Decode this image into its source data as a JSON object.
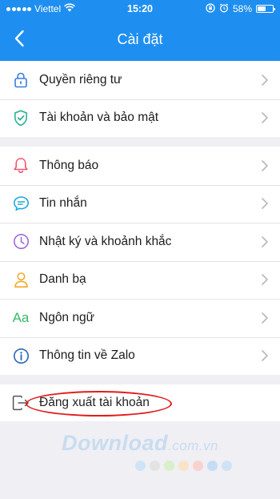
{
  "status_bar": {
    "carrier": "Viettel",
    "time": "15:20",
    "battery": "58%",
    "battery_level": 0.58
  },
  "header": {
    "title": "Cài đặt"
  },
  "sections": [
    {
      "items": [
        {
          "icon": "lock-icon",
          "label": "Quyền riêng tư"
        },
        {
          "icon": "shield-icon",
          "label": "Tài khoản và bảo mật"
        }
      ]
    },
    {
      "items": [
        {
          "icon": "bell-icon",
          "label": "Thông báo"
        },
        {
          "icon": "chat-bubble-icon",
          "label": "Tin nhắn"
        },
        {
          "icon": "clock-icon",
          "label": "Nhật ký và khoảnh khắc"
        },
        {
          "icon": "person-icon",
          "label": "Danh bạ"
        },
        {
          "icon": "language-icon",
          "label": "Ngôn ngữ",
          "icon_text": "Aa"
        },
        {
          "icon": "info-icon",
          "label": "Thông tin về Zalo"
        }
      ]
    }
  ],
  "logout": {
    "icon": "logout-icon",
    "label": "Đăng xuất tài khoản"
  },
  "watermark": {
    "brand": "Download",
    "domain": ".com.vn",
    "dot_colors": [
      "#cfe3f6",
      "#e3e3e3",
      "#d8efc9",
      "#fbe3c7",
      "#f9d2cf",
      "#c5ddf4",
      "#cfe3f6"
    ]
  },
  "colors": {
    "header_bg": "#1e8ff0",
    "background": "#efeff4",
    "lock": "#3a7de0",
    "shield": "#27b18f",
    "bell": "#f0566a",
    "chat": "#1aa6e0",
    "clock": "#9b6ae0",
    "person": "#f3a92b",
    "language": "#3bb96a",
    "info": "#2b66b8",
    "highlight": "#e21c1c"
  }
}
